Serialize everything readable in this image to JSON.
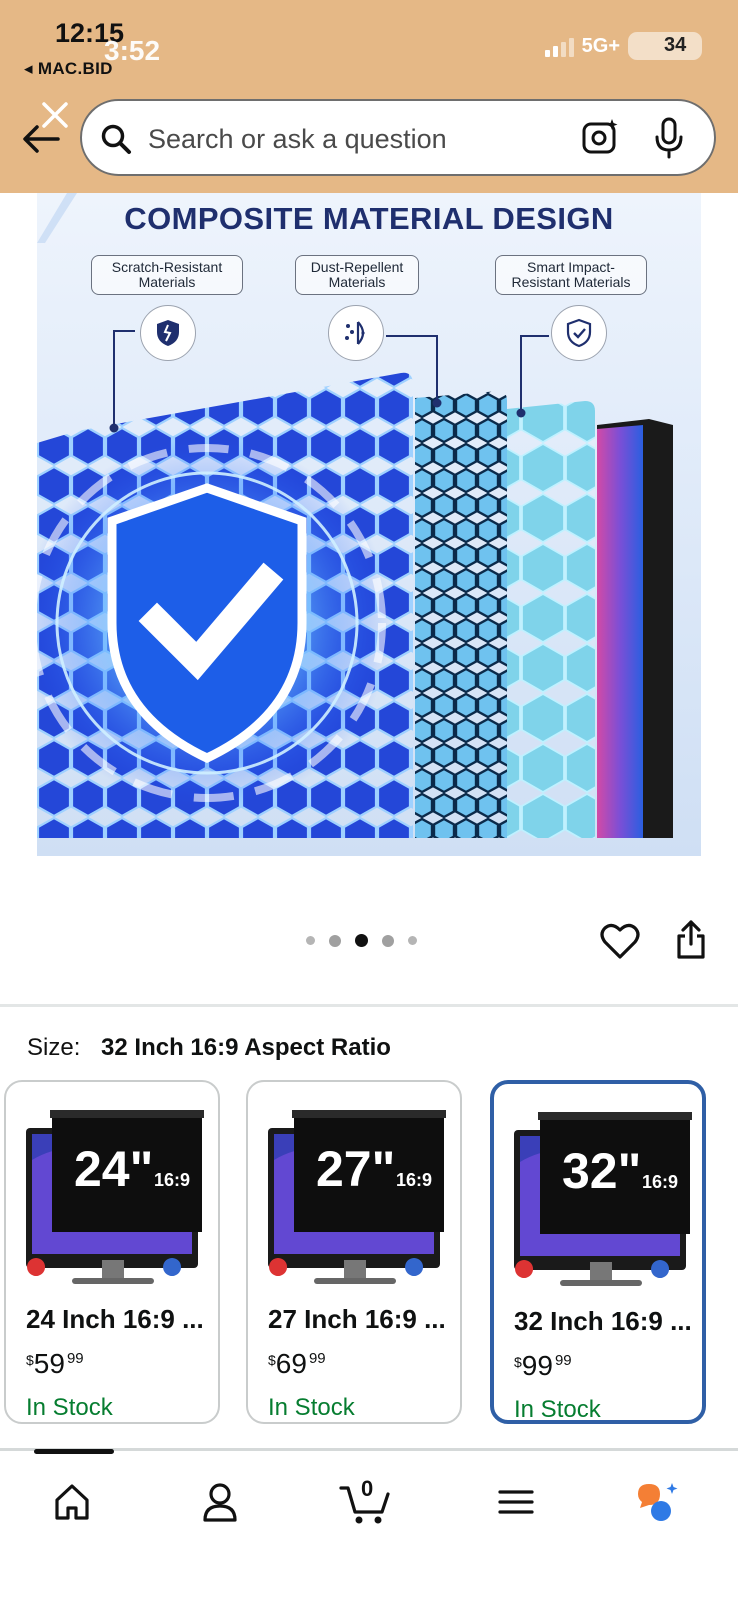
{
  "status_bar": {
    "time": "12:15",
    "time_overlay": "3:52",
    "back_app": "MAC.BID",
    "network": "5G+",
    "battery": "34"
  },
  "search": {
    "placeholder": "Search or ask a question"
  },
  "product_image": {
    "title": "COMPOSITE MATERIAL DESIGN",
    "features": [
      {
        "label": "Scratch-Resistant Materials",
        "icon": "shattered-shield-icon"
      },
      {
        "label": "Dust-Repellent Materials",
        "icon": "dust-particles-icon"
      },
      {
        "label": "Smart Impact-Resistant Materials",
        "icon": "check-shield-icon"
      }
    ],
    "carousel": {
      "total": 5,
      "active_index": 2
    }
  },
  "size_selector": {
    "label": "Size:",
    "selected_value": "32 Inch 16:9 Aspect Ratio",
    "options": [
      {
        "badge": "24\"",
        "ratio": "16:9",
        "name": "24 Inch 16:9 ...",
        "currency": "$",
        "price_whole": "59",
        "price_cents": "99",
        "stock": "In Stock",
        "selected": false
      },
      {
        "badge": "27\"",
        "ratio": "16:9",
        "name": "27 Inch 16:9 ...",
        "currency": "$",
        "price_whole": "69",
        "price_cents": "99",
        "stock": "In Stock",
        "selected": false
      },
      {
        "badge": "32\"",
        "ratio": "16:9",
        "name": "32 Inch 16:9 ...",
        "currency": "$",
        "price_whole": "99",
        "price_cents": "99",
        "stock": "In Stock",
        "selected": true
      }
    ]
  },
  "bottom_nav": {
    "cart_count": "0",
    "items": [
      "home-icon",
      "account-icon",
      "cart-icon",
      "menu-icon",
      "rufus-icon"
    ]
  },
  "colors": {
    "header_bg": "#e5b886",
    "selected_border": "#2f5fa6",
    "in_stock": "#067d30",
    "image_title": "#1f2f6e"
  }
}
